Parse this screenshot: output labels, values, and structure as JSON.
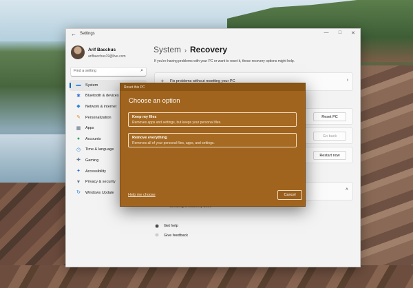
{
  "window": {
    "app_title": "Settings",
    "back_glyph": "←",
    "controls": [
      "—",
      "□",
      "✕"
    ]
  },
  "user": {
    "name": "Arif Bacchus",
    "email": "arifbacchus19@live.com"
  },
  "search": {
    "placeholder": "Find a setting",
    "icon": "search-icon"
  },
  "nav": {
    "items": [
      {
        "label": "System",
        "icon": "monitor-icon",
        "glyph": "▬",
        "color": "#3a8ee6",
        "active": true
      },
      {
        "label": "Bluetooth & devices",
        "icon": "bluetooth-icon",
        "glyph": "✱",
        "color": "#3a6fd8"
      },
      {
        "label": "Network & internet",
        "icon": "wifi-icon",
        "glyph": "◆",
        "color": "#2d86d8"
      },
      {
        "label": "Personalization",
        "icon": "brush-icon",
        "glyph": "✎",
        "color": "#d48a2e"
      },
      {
        "label": "Apps",
        "icon": "apps-icon",
        "glyph": "▦",
        "color": "#5a6b82"
      },
      {
        "label": "Accounts",
        "icon": "person-icon",
        "glyph": "●",
        "color": "#2fa36b"
      },
      {
        "label": "Time & language",
        "icon": "globe-clock-icon",
        "glyph": "◷",
        "color": "#2d86d8"
      },
      {
        "label": "Gaming",
        "icon": "gamepad-icon",
        "glyph": "✚",
        "color": "#6b7a8c"
      },
      {
        "label": "Accessibility",
        "icon": "accessibility-icon",
        "glyph": "✦",
        "color": "#2d6fd8"
      },
      {
        "label": "Privacy & security",
        "icon": "shield-icon",
        "glyph": "▼",
        "color": "#6b7a8c"
      },
      {
        "label": "Windows Update",
        "icon": "update-icon",
        "glyph": "↻",
        "color": "#2d86d8"
      }
    ]
  },
  "main": {
    "breadcrumb_parent": "System",
    "breadcrumb_separator": "›",
    "page_title": "Recovery",
    "intro": "If you're having problems with your PC or want to reset it, these recovery options might help.",
    "fix_problems": "Fix problems without resetting your PC",
    "reset_pc_button": "Reset PC",
    "go_back_button": "Go back",
    "restart_now_button": "Restart now",
    "recovery_drive": "Creating a recovery drive",
    "get_help": "Get help",
    "give_feedback": "Give feedback"
  },
  "dialog": {
    "title": "Reset this PC",
    "heading": "Choose an option",
    "options": [
      {
        "title": "Keep my files",
        "desc": "Removes apps and settings, but keeps your personal files."
      },
      {
        "title": "Remove everything",
        "desc": "Removes all of your personal files, apps, and settings."
      }
    ],
    "help_link": "Help me choose",
    "cancel_button": "Cancel"
  },
  "colors": {
    "accent": "#0067c0",
    "dialog_bg": "#a0641e"
  }
}
